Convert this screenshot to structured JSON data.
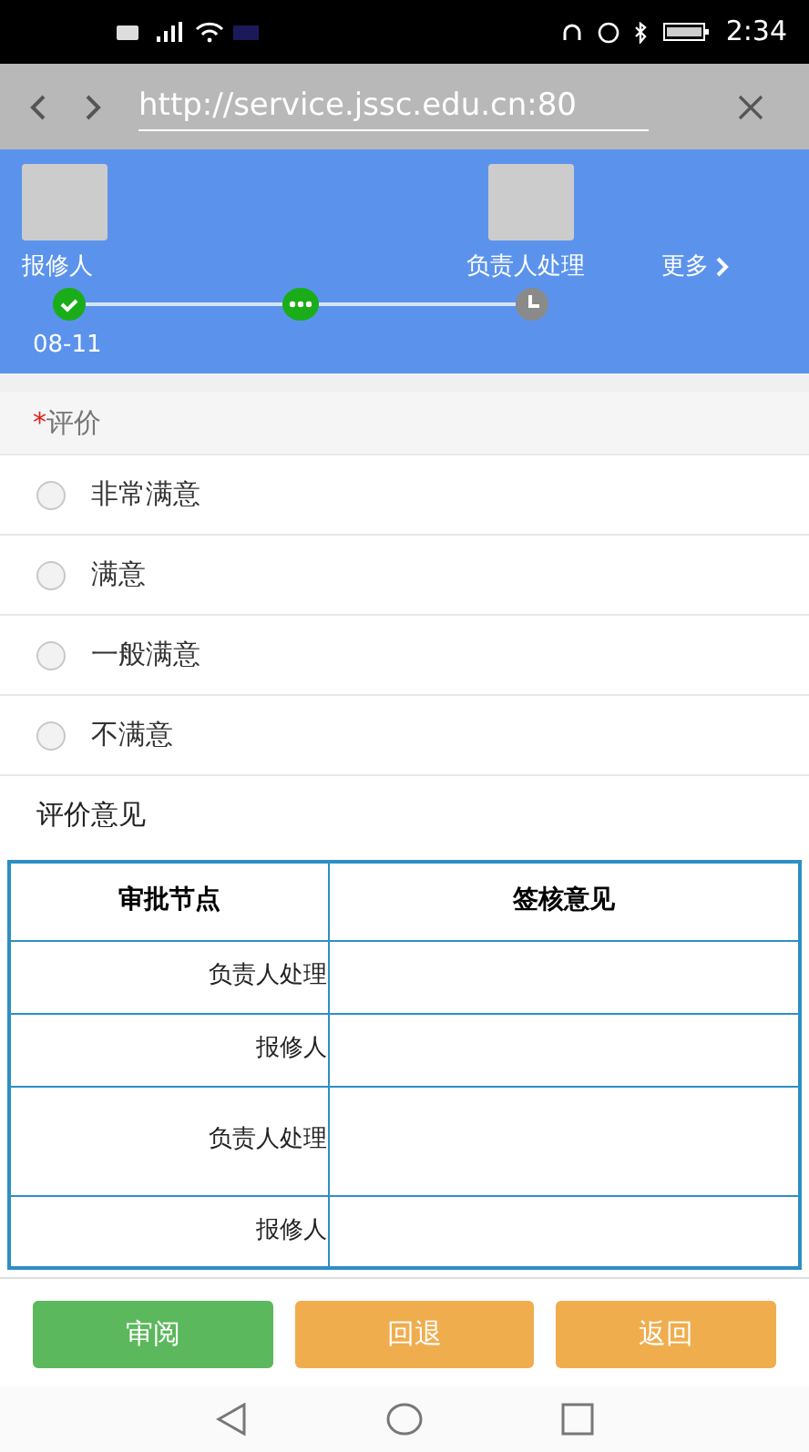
{
  "status_bar": {
    "time": "2:34"
  },
  "browser": {
    "url": "http://service.jssc.edu.cn:80"
  },
  "progress": {
    "steps": [
      {
        "label": "报修人",
        "kind": "done",
        "date": "08-11",
        "avatar": true
      },
      {
        "kind": "current",
        "avatar": false
      },
      {
        "label": "负责人处理",
        "kind": "pending",
        "avatar": true
      }
    ],
    "more": "更多"
  },
  "rating": {
    "title": "评价",
    "required_mark": "*",
    "options": [
      {
        "label": "非常满意",
        "selected": false
      },
      {
        "label": "满意",
        "selected": false
      },
      {
        "label": "一般满意",
        "selected": false
      },
      {
        "label": "不满意",
        "selected": false
      }
    ]
  },
  "comment": {
    "label": "评价意见"
  },
  "table": {
    "columns": [
      "审批节点",
      "签核意见"
    ],
    "rows": [
      {
        "node": "负责人处理",
        "tall": false
      },
      {
        "node": "报修人",
        "tall": false
      },
      {
        "node": "负责人处理",
        "tall": true
      },
      {
        "node": "报修人",
        "tall": false
      }
    ]
  },
  "buttons": [
    {
      "label": "审阅",
      "kind": "primary"
    },
    {
      "label": "回退",
      "kind": "warning"
    },
    {
      "label": "返回",
      "kind": "warning"
    }
  ]
}
